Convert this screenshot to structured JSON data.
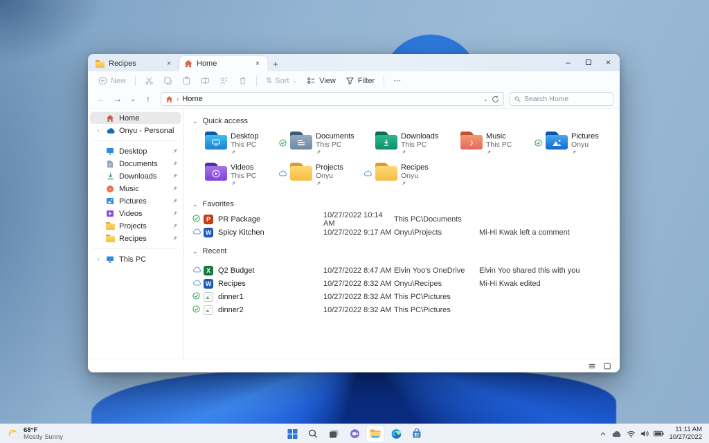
{
  "icons": {
    "tab_close": "×",
    "new_tab": "+",
    "minimize": "–",
    "close": "×",
    "back": "←",
    "forward": "→",
    "dropdown": "⌄",
    "up": "↑",
    "crumb_sep": "›",
    "section_chevron": "⌄",
    "expand_chevron": "›",
    "sort_arrows": "⇅",
    "more": "⋯",
    "music_note": "♪"
  },
  "colors": {
    "accent": "#0f6cbd",
    "sync_green": "#189a3a",
    "cloud_blue": "#4a90d9",
    "powerpoint": "#c43e1c",
    "word": "#185abd",
    "excel": "#107c41",
    "folder_yellow": "#f6bc45"
  },
  "window": {
    "tabs": [
      {
        "label": "Recipes"
      },
      {
        "label": "Home"
      }
    ],
    "toolbar": {
      "new": "New",
      "sort": "Sort",
      "view": "View",
      "filter": "Filter"
    },
    "address": {
      "breadcrumb_root": "Home",
      "search_placeholder": "Search Home"
    },
    "sidebar": {
      "items": [
        {
          "label": "Home"
        },
        {
          "label": "Onyu - Personal"
        },
        {
          "label": "Desktop"
        },
        {
          "label": "Documents"
        },
        {
          "label": "Downloads"
        },
        {
          "label": "Music"
        },
        {
          "label": "Pictures"
        },
        {
          "label": "Videos"
        },
        {
          "label": "Projects"
        },
        {
          "label": "Recipes"
        },
        {
          "label": "This PC"
        }
      ]
    },
    "quick_access": {
      "title": "Quick access",
      "tiles": [
        {
          "name": "Desktop",
          "location": "This PC",
          "status": ""
        },
        {
          "name": "Documents",
          "location": "This PC",
          "status": "synced"
        },
        {
          "name": "Downloads",
          "location": "This PC",
          "status": ""
        },
        {
          "name": "Music",
          "location": "This PC",
          "status": ""
        },
        {
          "name": "Pictures",
          "location": "Onyu",
          "status": "synced"
        },
        {
          "name": "Videos",
          "location": "This PC",
          "status": ""
        },
        {
          "name": "Projects",
          "location": "Onyu",
          "status": "cloud"
        },
        {
          "name": "Recipes",
          "location": "Onyu",
          "status": "cloud"
        }
      ]
    },
    "favorites": {
      "title": "Favorites",
      "rows": [
        {
          "name": "PR Package",
          "type": "powerpoint",
          "status": "synced",
          "date": "10/27/2022 10:14 AM",
          "location": "This PC\\Documents",
          "activity": ""
        },
        {
          "name": "Spicy Kitchen",
          "type": "word",
          "status": "cloud",
          "date": "10/27/2022 9:17 AM",
          "location": "Onyu\\Projects",
          "activity": "Mi-Hi Kwak left a comment"
        }
      ]
    },
    "recent": {
      "title": "Recent",
      "rows": [
        {
          "name": "Q2 Budget",
          "type": "excel",
          "status": "cloud",
          "date": "10/27/2022 8:47 AM",
          "location": "Elvin Yoo's OneDrive",
          "activity": "Elvin Yoo shared this with you"
        },
        {
          "name": "Recipes",
          "type": "word",
          "status": "cloud",
          "date": "10/27/2022 8:32 AM",
          "location": "Onyu\\Recipes",
          "activity": "Mi-Hi Kwak edited"
        },
        {
          "name": "dinner1",
          "type": "image",
          "status": "synced",
          "date": "10/27/2022 8:32 AM",
          "location": "This PC\\Pictures",
          "activity": ""
        },
        {
          "name": "dinner2",
          "type": "image",
          "status": "synced",
          "date": "10/27/2022 8:32 AM",
          "location": "This PC\\Pictures",
          "activity": ""
        }
      ]
    }
  },
  "taskbar": {
    "weather": {
      "temp": "68°F",
      "condition": "Mostly Sunny"
    },
    "clock": {
      "time": "11:11 AM",
      "date": "10/27/2022"
    }
  }
}
